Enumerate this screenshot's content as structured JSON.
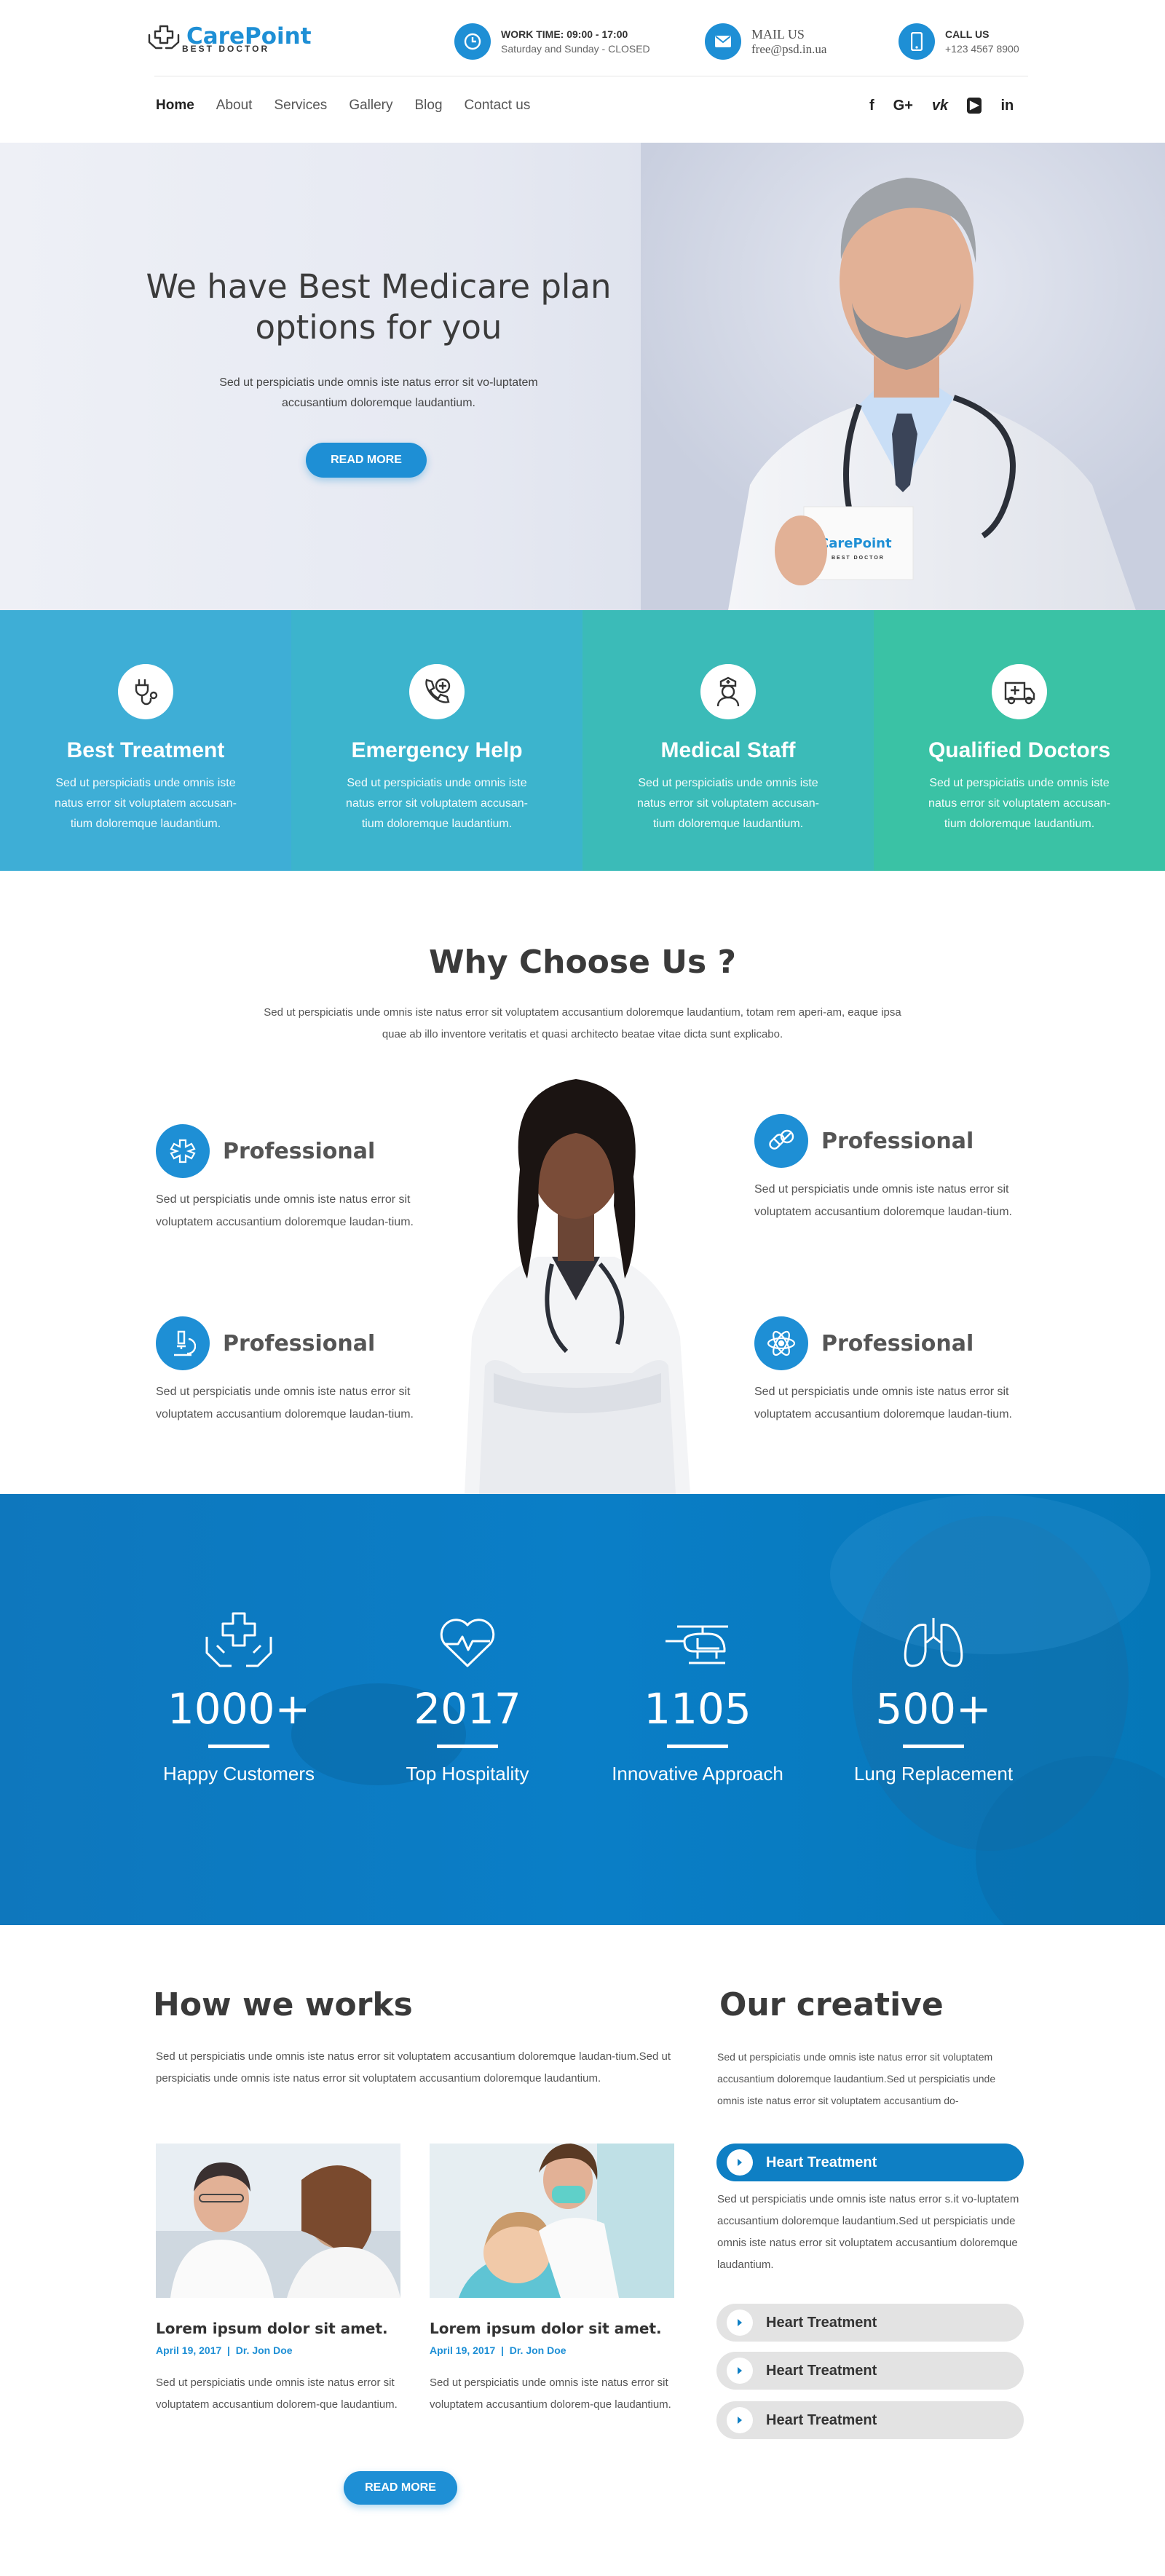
{
  "brand": {
    "name_part1": "Care",
    "name_part2": "Point",
    "tagline": "BEST DOCTOR",
    "accent": "#1e8fd5"
  },
  "header": {
    "work": {
      "title": "WORK TIME: 09:00 - 17:00",
      "detail": "Saturday and Sunday - CLOSED",
      "icon": "clock-icon"
    },
    "mail": {
      "title": "MAIL US",
      "detail": "free@psd.in.ua",
      "icon": "envelope-icon"
    },
    "call": {
      "title": "CALL US",
      "detail": "+123 4567 8900",
      "icon": "phone-icon"
    }
  },
  "nav": {
    "items": [
      "Home",
      "About",
      "Services",
      "Gallery",
      "Blog",
      "Contact us"
    ],
    "active": "Home"
  },
  "social": [
    "f",
    "G+",
    "vk",
    "▶",
    "in"
  ],
  "hero": {
    "title": "We have Best Medicare plan options for you",
    "text": "Sed ut perspiciatis unde omnis iste natus error sit vo-luptatem accusantium doloremque laudantium.",
    "button": "READ MORE",
    "card_brand": "CarePoint",
    "card_tag": "BEST DOCTOR"
  },
  "features": [
    {
      "title": "Best Treatment",
      "text": "Sed ut perspiciatis unde omnis iste natus error sit voluptatem accusan-tium doloremque laudantium.",
      "icon": "plug-stethoscope-icon",
      "color": "#3daed4"
    },
    {
      "title": "Emergency Help",
      "text": "Sed ut perspiciatis unde omnis iste natus error sit voluptatem accusan-tium doloremque laudantium.",
      "icon": "emergency-phone-icon",
      "color": "#3bb4cc"
    },
    {
      "title": "Medical Staff",
      "text": "Sed ut perspiciatis unde omnis iste natus error sit voluptatem accusan-tium doloremque laudantium.",
      "icon": "nurse-icon",
      "color": "#3abbb8"
    },
    {
      "title": "Qualified Doctors",
      "text": "Sed ut perspiciatis unde omnis iste natus error sit voluptatem accusan-tium doloremque laudantium.",
      "icon": "ambulance-icon",
      "color": "#39c2a4"
    }
  ],
  "why": {
    "title": "Why Choose Us ?",
    "text": "Sed ut perspiciatis unde omnis iste natus error sit voluptatem accusantium doloremque laudantium, totam rem aperi-am, eaque ipsa quae ab illo inventore veritatis et quasi architecto beatae vitae dicta sunt explicabo.",
    "items": [
      {
        "title": "Professional",
        "text": "Sed ut perspiciatis unde omnis iste natus error sit voluptatem accusantium doloremque laudan-tium.",
        "icon": "medical-star-icon"
      },
      {
        "title": "Professional",
        "text": "Sed ut perspiciatis unde omnis iste natus error sit voluptatem accusantium doloremque laudan-tium.",
        "icon": "pills-icon"
      },
      {
        "title": "Professional",
        "text": "Sed ut perspiciatis unde omnis iste natus error sit voluptatem accusantium doloremque laudan-tium.",
        "icon": "microscope-icon"
      },
      {
        "title": "Professional",
        "text": "Sed ut perspiciatis unde omnis iste natus error sit voluptatem accusantium doloremque laudan-tium.",
        "icon": "atom-icon"
      }
    ]
  },
  "stats": [
    {
      "number": "1000+",
      "label": "Happy Customers",
      "icon": "hands-cross-icon"
    },
    {
      "number": "2017",
      "label": "Top Hospitality",
      "icon": "heartbeat-icon"
    },
    {
      "number": "1105",
      "label": "Innovative Approach",
      "icon": "helicopter-icon"
    },
    {
      "number": "500+",
      "label": "Lung Replacement",
      "icon": "lungs-icon"
    }
  ],
  "how": {
    "title": "How we works",
    "text": "Sed ut perspiciatis unde omnis iste natus error sit voluptatem accusantium doloremque laudan-tium.Sed ut perspiciatis unde omnis iste natus error sit voluptatem accusantium doloremque laudantium.",
    "posts": [
      {
        "title": "Lorem ipsum dolor sit amet.",
        "date": "April 19, 2017",
        "author": "Dr. Jon Doe",
        "text": "Sed ut perspiciatis unde omnis iste natus error sit voluptatem accusantium dolorem-que laudantium."
      },
      {
        "title": "Lorem ipsum dolor sit amet.",
        "date": "April 19, 2017",
        "author": "Dr. Jon Doe",
        "text": "Sed ut perspiciatis unde omnis iste natus error sit voluptatem accusantium dolorem-que laudantium."
      }
    ],
    "button": "READ MORE"
  },
  "creative": {
    "title": "Our creative",
    "text": "Sed ut perspiciatis unde omnis iste natus error sit voluptatem accusantium doloremque laudantium.Sed ut perspiciatis unde omnis iste natus error sit voluptatem accusantium do-",
    "accordion": [
      {
        "label": "Heart Treatment",
        "open": true,
        "body": "Sed ut perspiciatis unde omnis iste natus error s.it vo-luptatem accusantium doloremque laudantium.Sed ut perspiciatis unde omnis iste natus error sit voluptatem accusantium doloremque laudantium."
      },
      {
        "label": "Heart Treatment",
        "open": false
      },
      {
        "label": "Heart Treatment",
        "open": false
      },
      {
        "label": "Heart Treatment",
        "open": false
      }
    ]
  }
}
